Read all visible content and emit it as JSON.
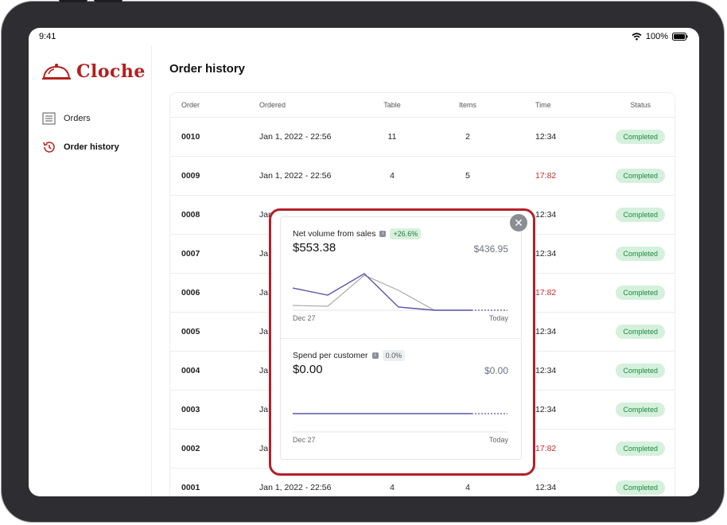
{
  "status_bar": {
    "time": "9:41",
    "battery": "100%"
  },
  "brand": {
    "name": "Cloche",
    "color": "#b51f1f"
  },
  "sidebar": {
    "items": [
      {
        "label": "Orders",
        "icon": "list-icon",
        "active": false
      },
      {
        "label": "Order history",
        "icon": "history-icon",
        "active": true
      }
    ]
  },
  "page": {
    "title": "Order history"
  },
  "table": {
    "columns": [
      "Order",
      "Ordered",
      "Table",
      "Items",
      "Time",
      "Status"
    ],
    "rows": [
      {
        "order": "0010",
        "ordered": "Jan 1, 2022 - 22:56",
        "table": "11",
        "items": "2",
        "time": "12:34",
        "status": "Completed"
      },
      {
        "order": "0009",
        "ordered": "Jan 1, 2022 - 22:56",
        "table": "4",
        "items": "5",
        "time": "17:82",
        "status": "Completed"
      },
      {
        "order": "0008",
        "ordered": "Jan",
        "table": "",
        "items": "",
        "time": "12:34",
        "status": "Completed"
      },
      {
        "order": "0007",
        "ordered": "Ja",
        "table": "",
        "items": "",
        "time": "12:34",
        "status": "Completed"
      },
      {
        "order": "0006",
        "ordered": "Ja",
        "table": "",
        "items": "",
        "time": "17:82",
        "status": "Completed"
      },
      {
        "order": "0005",
        "ordered": "Ja",
        "table": "",
        "items": "",
        "time": "12:34",
        "status": "Completed"
      },
      {
        "order": "0004",
        "ordered": "Ja",
        "table": "",
        "items": "",
        "time": "12:34",
        "status": "Completed"
      },
      {
        "order": "0003",
        "ordered": "Ja",
        "table": "",
        "items": "",
        "time": "12:34",
        "status": "Completed"
      },
      {
        "order": "0002",
        "ordered": "Ja",
        "table": "",
        "items": "",
        "time": "17:82",
        "status": "Completed"
      },
      {
        "order": "0001",
        "ordered": "Jan 1, 2022 - 22:56",
        "table": "4",
        "items": "4",
        "time": "12:34",
        "status": "Completed"
      }
    ]
  },
  "popup": {
    "panels": [
      {
        "title": "Net volume from sales",
        "change": "+26.6%",
        "value": "$553.38",
        "compare": "$436.95",
        "start_label": "Dec 27",
        "end_label": "Today"
      },
      {
        "title": "Spend per customer",
        "change": "0.0%",
        "value": "$0.00",
        "compare": "$0.00",
        "start_label": "Dec 27",
        "end_label": "Today"
      }
    ]
  },
  "colors": {
    "accent": "#b51f1f",
    "badge_bg": "#d5f0dc",
    "badge_text": "#1d8a3e",
    "late_time": "#c22d2d",
    "series": "#5b55a8"
  }
}
